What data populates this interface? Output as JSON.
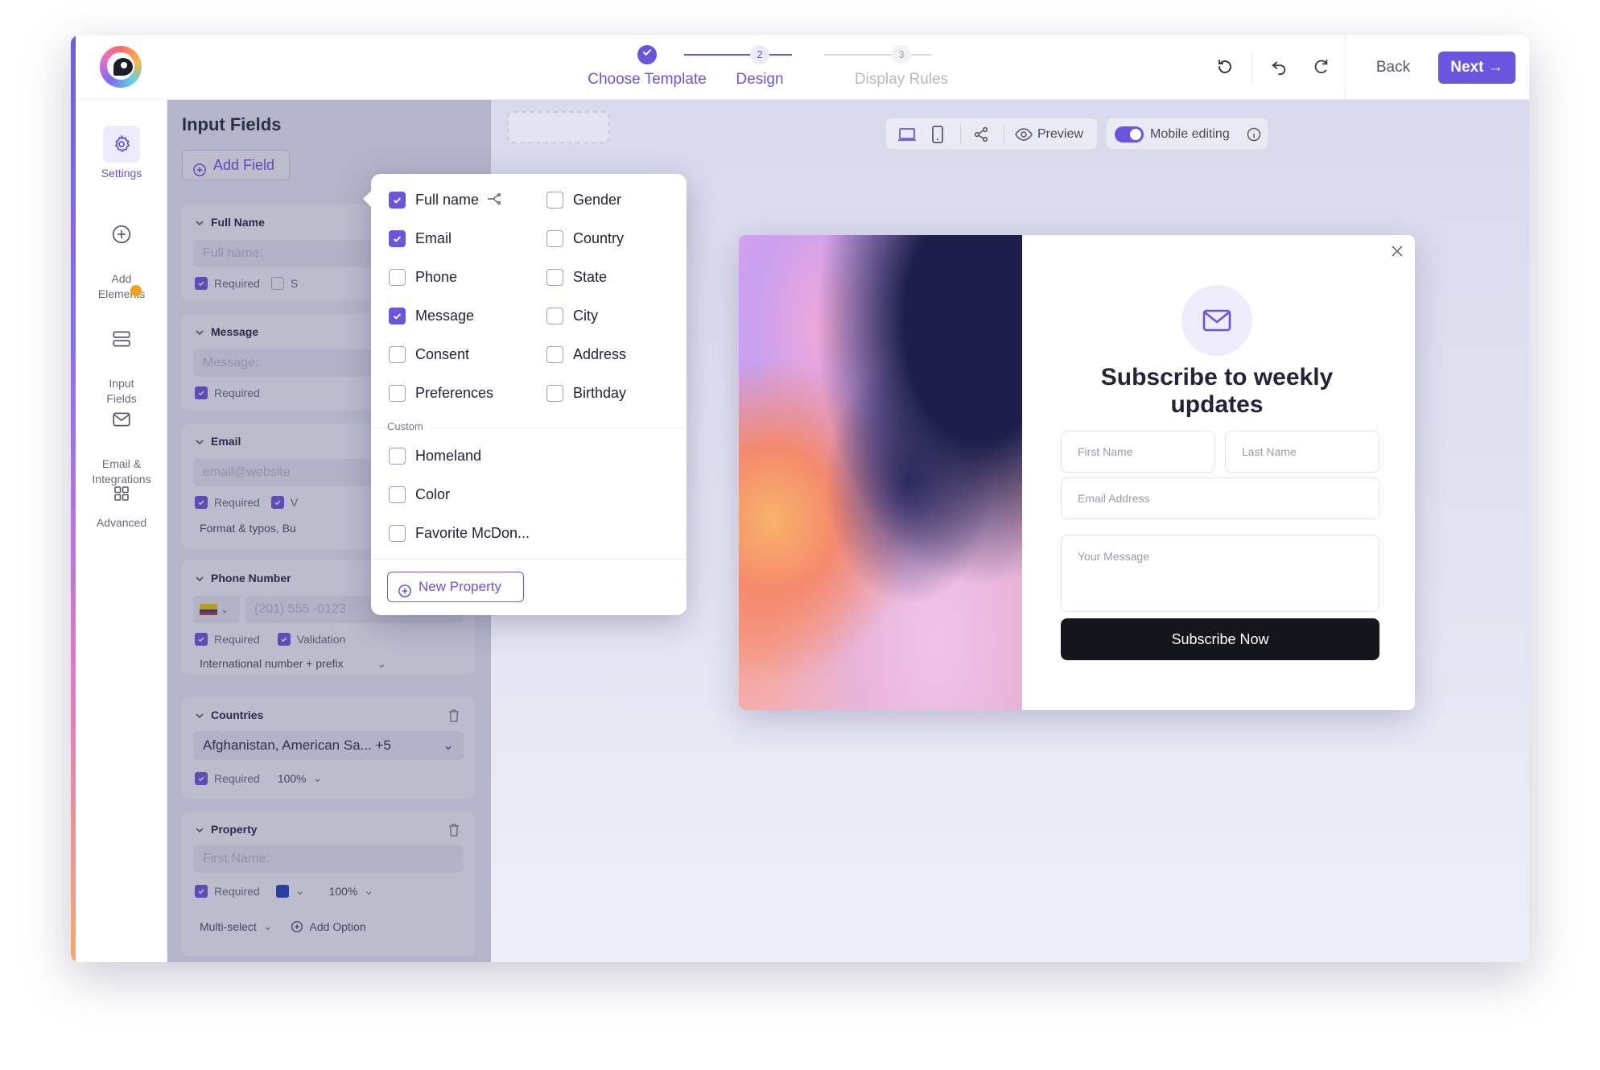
{
  "stepper": {
    "steps": [
      {
        "number": "1",
        "label": "Choose Template",
        "state": "done"
      },
      {
        "number": "2",
        "label": "Design",
        "state": "active"
      },
      {
        "number": "3",
        "label": "Display Rules",
        "state": "upcoming"
      }
    ]
  },
  "header": {
    "back_label": "Back",
    "next_label": "Next"
  },
  "rail": {
    "items": [
      {
        "label": "Settings",
        "icon": "gear-icon",
        "active": true
      },
      {
        "label": "Add\nElements",
        "icon": "plus-circle-icon"
      },
      {
        "label": "Input\nFields",
        "icon": "fields-icon",
        "badge": true
      },
      {
        "label": "Email &\nIntegrations",
        "icon": "envelope-icon"
      },
      {
        "label": "Advanced",
        "icon": "grid-icon"
      }
    ]
  },
  "panel": {
    "title": "Input Fields",
    "add_field_label": "Add Field",
    "cards": {
      "full_name": {
        "title": "Full Name",
        "placeholder": "Full name:",
        "required_label": "Required",
        "required": true,
        "second_label": "S"
      },
      "message": {
        "title": "Message",
        "placeholder": "Message:",
        "required_label": "Required",
        "required": true
      },
      "email": {
        "title": "Email",
        "placeholder": "email@website",
        "required_label": "Required",
        "required": true,
        "second_label": "V",
        "format_label": "Format & typos, Bu"
      },
      "phone": {
        "title": "Phone Number",
        "placeholder": "(201) 555 -0123",
        "required_label": "Required",
        "validation_label": "Validation",
        "format_value": "International number + prefix"
      },
      "countries": {
        "title": "Countries",
        "value": "Afghanistan, American Sa... +5",
        "required_label": "Required",
        "width_value": "100%"
      },
      "property": {
        "title": "Property",
        "placeholder": "First Name:",
        "required_label": "Required",
        "width_value": "100%",
        "color": "#1f3fbf",
        "multi_label": "Multi-select",
        "add_option_label": "Add Option"
      }
    }
  },
  "dropdown": {
    "left_items": [
      {
        "label": "Full name",
        "checked": true,
        "has_share_icon": true
      },
      {
        "label": "Email",
        "checked": true
      },
      {
        "label": "Phone",
        "checked": false
      },
      {
        "label": "Message",
        "checked": true
      },
      {
        "label": "Consent",
        "checked": false
      },
      {
        "label": "Preferences",
        "checked": false
      }
    ],
    "right_items": [
      {
        "label": "Gender",
        "checked": false
      },
      {
        "label": "Country",
        "checked": false
      },
      {
        "label": "State",
        "checked": false
      },
      {
        "label": "City",
        "checked": false
      },
      {
        "label": "Address",
        "checked": false
      },
      {
        "label": "Birthday",
        "checked": false
      }
    ],
    "custom_label": "Custom",
    "custom_items": [
      {
        "label": "Homeland",
        "checked": false
      },
      {
        "label": "Color",
        "checked": false
      },
      {
        "label": "Favorite McDon...",
        "checked": false
      }
    ],
    "new_property_label": "New Property"
  },
  "toolbar": {
    "preview_label": "Preview",
    "mobile_editing_label": "Mobile editing",
    "mobile_editing_on": true
  },
  "popup": {
    "title": "Subscribe to weekly updates",
    "first_name_placeholder": "First Name",
    "last_name_placeholder": "Last Name",
    "email_placeholder": "Email Address",
    "message_placeholder": "Your Message",
    "button_label": "Subscribe Now"
  },
  "colors": {
    "accent": "#6a55df",
    "button_dark": "#15151c",
    "badge": "#f4a01b"
  }
}
